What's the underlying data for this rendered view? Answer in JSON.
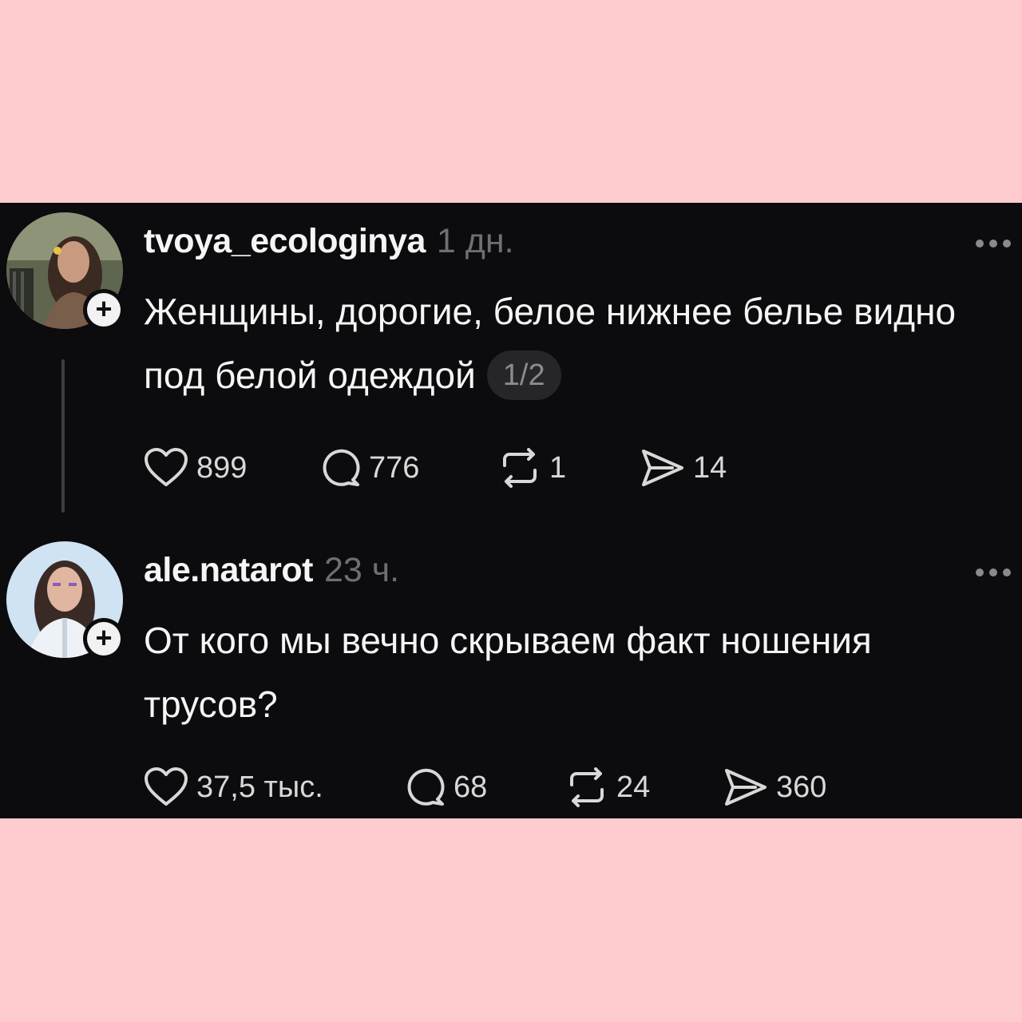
{
  "posts": [
    {
      "username": "tvoya_ecologinya",
      "time": "1 дн.",
      "text": "Женщины, дорогие, белое нижнее белье видно под белой одеждой",
      "page_indicator": "1/2",
      "stats": {
        "likes": "899",
        "replies": "776",
        "reposts": "1",
        "shares": "14"
      },
      "follow_icon": "plus-icon"
    },
    {
      "username": "ale.natarot",
      "time": "23 ч.",
      "text": "От кого мы вечно скрываем факт ношения трусов?",
      "stats": {
        "likes": "37,5 тыс.",
        "replies": "68",
        "reposts": "24",
        "shares": "360"
      },
      "follow_icon": "plus-icon"
    }
  ],
  "icons": [
    "heart-icon",
    "comment-icon",
    "repost-icon",
    "send-icon",
    "more-icon"
  ],
  "colors": {
    "background": "#fecbcf",
    "panel": "#0c0b0d",
    "text": "#f5f5f5",
    "muted": "#6f6f72"
  }
}
